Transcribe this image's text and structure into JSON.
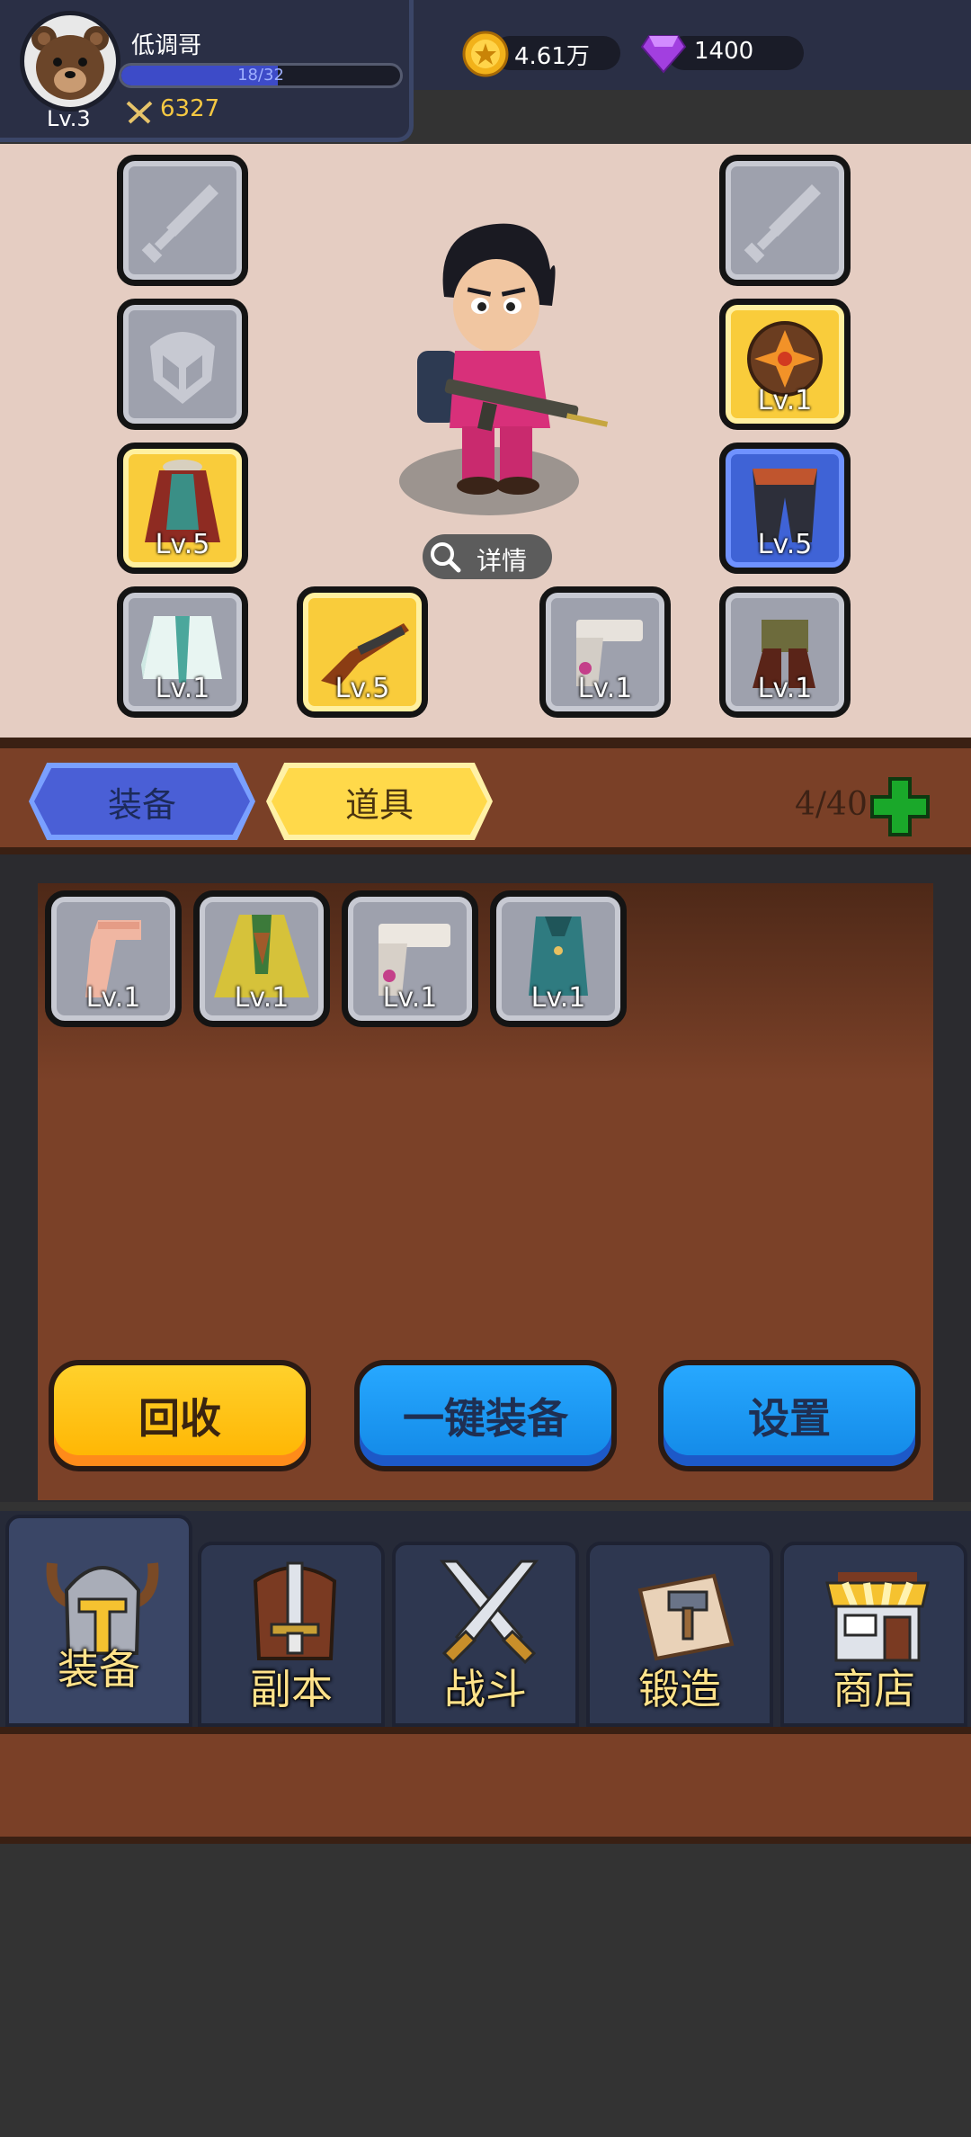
{
  "player": {
    "name": "低调哥",
    "level": "Lv.3",
    "xp_text": "18/32",
    "xp_fraction": 0.5625,
    "power": "6327"
  },
  "currency": {
    "gold": "4.61万",
    "gems": "1400"
  },
  "equipment_slots": {
    "left_top_lv": "",
    "left_helmet_lv": "",
    "left_cloak_lv": "Lv.5",
    "left_jacket_lv": "Lv.1",
    "rifle_lv": "Lv.5",
    "pistol_lv": "Lv.1",
    "right_top_lv": "",
    "right_shield_lv": "Lv.1",
    "right_pants_lv": "Lv.5",
    "right_boots_lv": "Lv.1"
  },
  "detail_label": "详情",
  "tabs": {
    "equipment": "装备",
    "items": "道具",
    "capacity": "4/40"
  },
  "inventory": [
    {
      "icon": "pistol-pink-icon",
      "level": "Lv.1"
    },
    {
      "icon": "cape-green-icon",
      "level": "Lv.1"
    },
    {
      "icon": "pistol-silver-icon",
      "level": "Lv.1"
    },
    {
      "icon": "vest-teal-icon",
      "level": "Lv.1"
    }
  ],
  "actions": {
    "recycle": "回收",
    "auto_equip": "一键装备",
    "settings": "设置"
  },
  "nav": {
    "equipment": "装备",
    "dungeon": "副本",
    "battle": "战斗",
    "forge": "锻造",
    "shop": "商店"
  },
  "colors": {
    "gold_slot": "#f9cc3b",
    "blue_slot": "#3f63d6",
    "gray_slot": "#9ea1ad",
    "panel_brown": "#7b4128"
  }
}
